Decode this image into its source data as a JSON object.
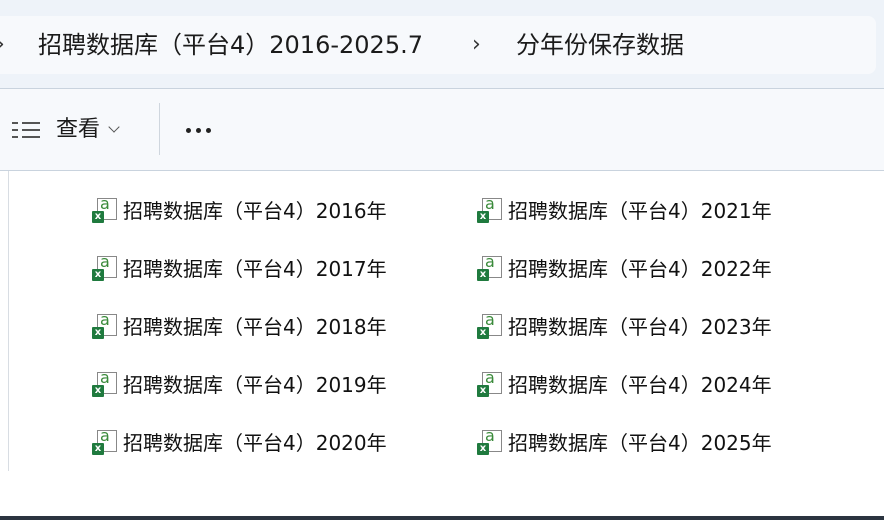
{
  "breadcrumb": {
    "separator": "›",
    "items": [
      {
        "label": "招聘数据库（平台4）2016-2025.7"
      },
      {
        "label": "分年份保存数据"
      }
    ]
  },
  "toolbar": {
    "view_label": "查看",
    "more_label": "..."
  },
  "files": {
    "icon_letter": "a",
    "badge_letter": "x",
    "items": [
      {
        "name": "招聘数据库（平台4）2016年"
      },
      {
        "name": "招聘数据库（平台4）2017年"
      },
      {
        "name": "招聘数据库（平台4）2018年"
      },
      {
        "name": "招聘数据库（平台4）2019年"
      },
      {
        "name": "招聘数据库（平台4）2020年"
      },
      {
        "name": "招聘数据库（平台4）2021年"
      },
      {
        "name": "招聘数据库（平台4）2022年"
      },
      {
        "name": "招聘数据库（平台4）2023年"
      },
      {
        "name": "招聘数据库（平台4）2024年"
      },
      {
        "name": "招聘数据库（平台4）2025年"
      }
    ]
  }
}
